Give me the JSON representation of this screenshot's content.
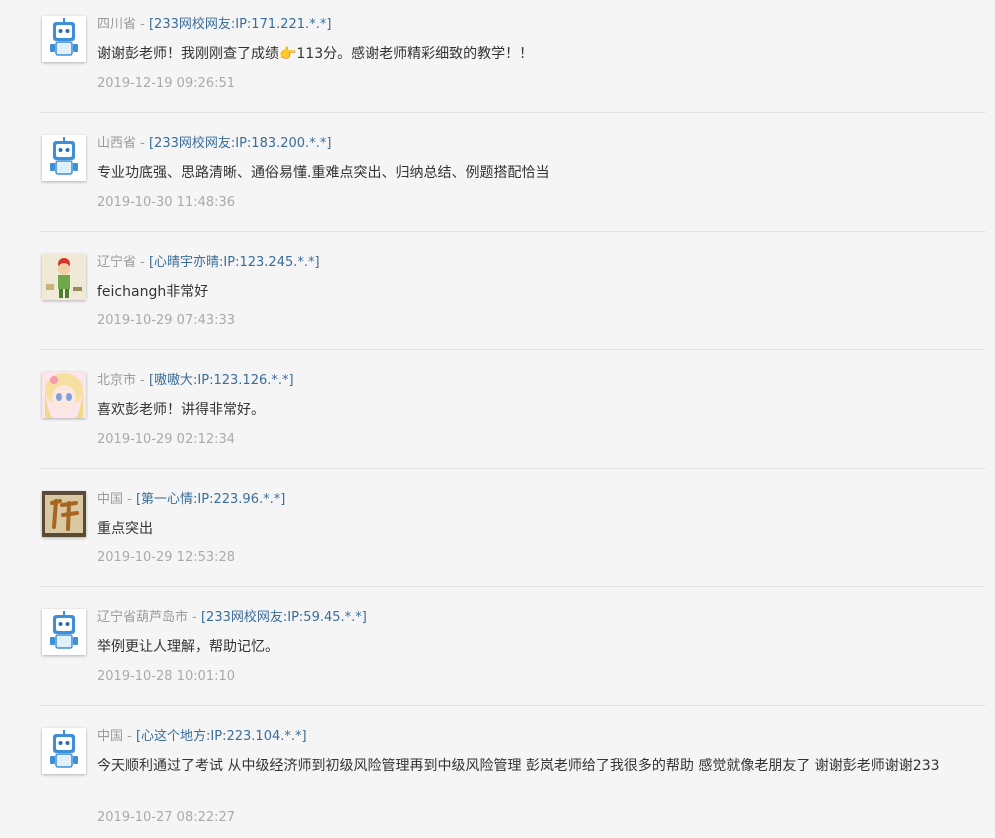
{
  "comments": [
    {
      "region": "四川省",
      "sep": " - ",
      "user": "[233网校网友:IP:171.221.*.*]",
      "text": "谢谢彭老师！我刚刚查了成绩👉113分。感谢老师精彩细致的教学！！",
      "time": "2019-12-19 09:26:51",
      "avatar_icon": "robot-avatar-icon"
    },
    {
      "region": "山西省",
      "sep": " - ",
      "user": "[233网校网友:IP:183.200.*.*]",
      "text": "专业功底强、思路清晰、通俗易懂.重难点突出、归纳总结、例题搭配恰当",
      "time": "2019-10-30 11:48:36",
      "avatar_icon": "robot-avatar-icon"
    },
    {
      "region": "辽宁省",
      "sep": " - ",
      "user": "[心晴宇亦晴:IP:123.245.*.*]",
      "text": "feichangh非常好",
      "time": "2019-10-29 07:43:33",
      "avatar_icon": "cartoon-boy-avatar-icon"
    },
    {
      "region": "北京市",
      "sep": " - ",
      "user": "[嗷嗷大:IP:123.126.*.*]",
      "text": "喜欢彭老师！讲得非常好。",
      "time": "2019-10-29 02:12:34",
      "avatar_icon": "anime-girl-avatar-icon"
    },
    {
      "region": "中国",
      "sep": " - ",
      "user": "[第一心情:IP:223.96.*.*]",
      "text": "重点突出",
      "time": "2019-10-29 12:53:28",
      "avatar_icon": "calligraphy-avatar-icon"
    },
    {
      "region": "辽宁省葫芦岛市",
      "sep": " - ",
      "user": "[233网校网友:IP:59.45.*.*]",
      "text": "举例更让人理解，帮助记忆。",
      "time": "2019-10-28 10:01:10",
      "avatar_icon": "robot-avatar-icon"
    },
    {
      "region": "中国",
      "sep": " - ",
      "user": "[心这个地方:IP:223.104.*.*]",
      "text": "今天顺利通过了考试 从中级经济师到初级风险管理再到中级风险管理 彭岚老师给了我很多的帮助 感觉就像老朋友了 谢谢彭老师谢谢233",
      "time": "2019-10-27 08:22:27",
      "avatar_icon": "robot-avatar-icon"
    }
  ]
}
